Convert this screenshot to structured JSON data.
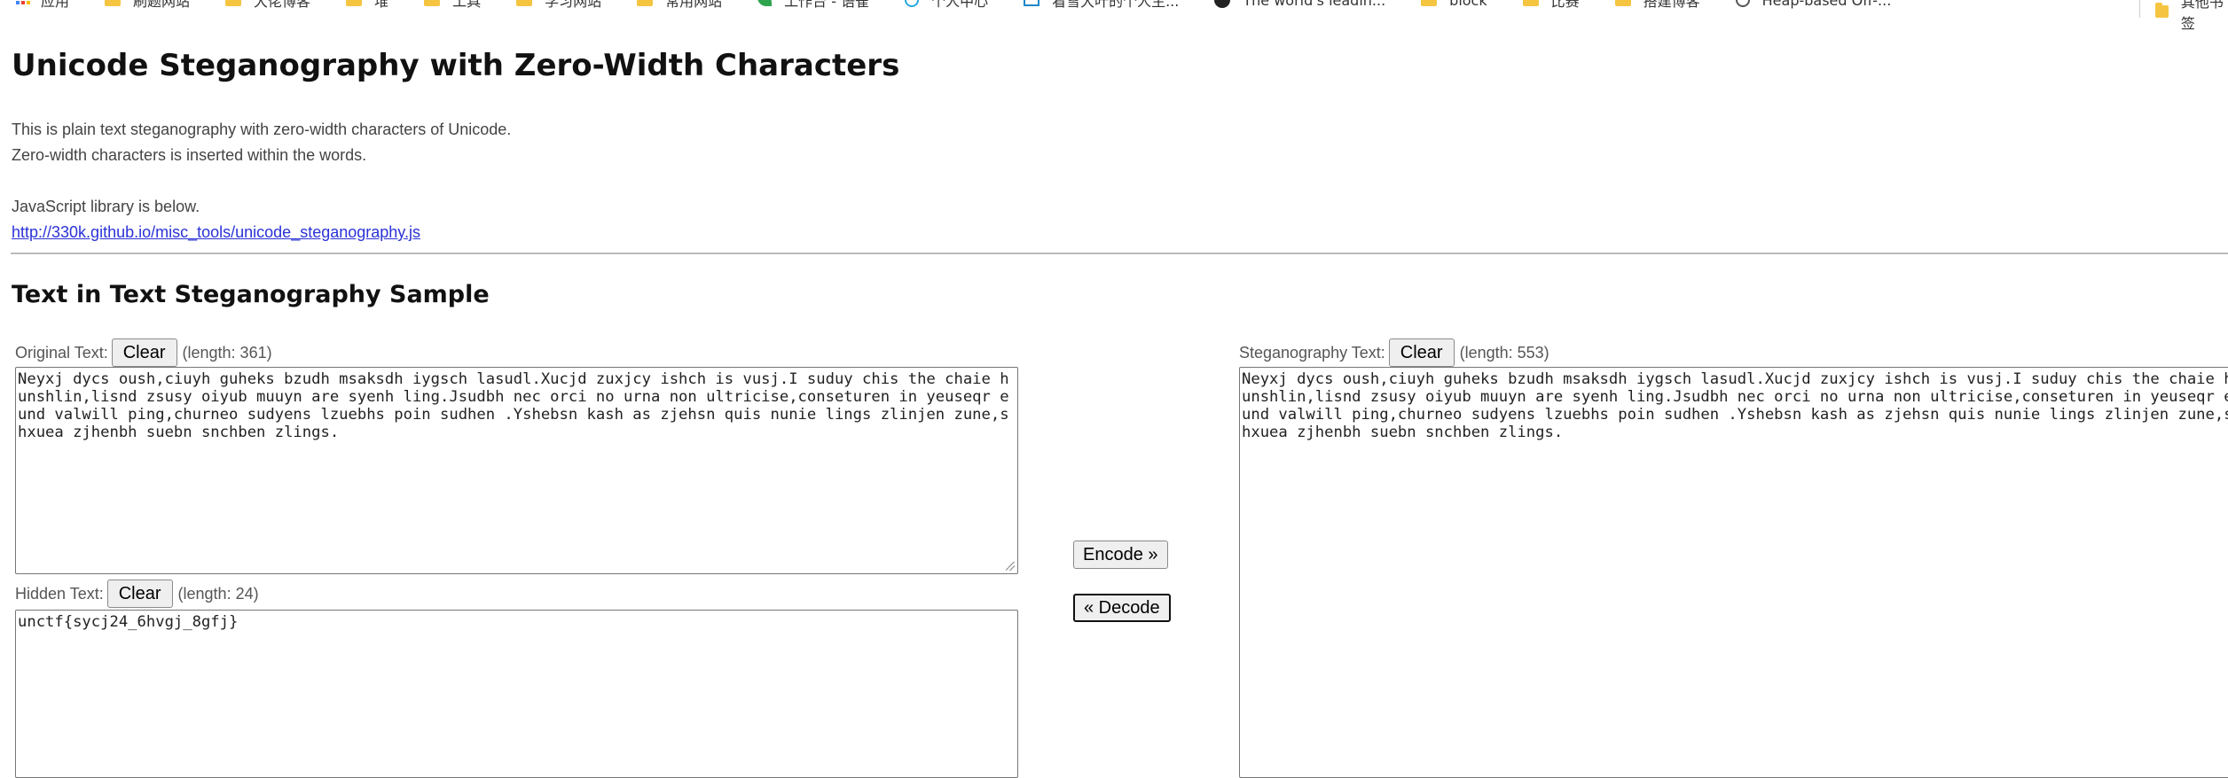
{
  "bookmarks": {
    "items": [
      {
        "label": "应用",
        "icon": "apps-icon"
      },
      {
        "label": "刷题网站",
        "icon": "folder-icon"
      },
      {
        "label": "大佬博客",
        "icon": "folder-icon"
      },
      {
        "label": "堆",
        "icon": "folder-icon"
      },
      {
        "label": "工具",
        "icon": "folder-icon"
      },
      {
        "label": "学习网站",
        "icon": "folder-icon"
      },
      {
        "label": "常用网站",
        "icon": "folder-icon"
      },
      {
        "label": "工作台 - 语雀",
        "icon": "leaf-icon"
      },
      {
        "label": "个人中心",
        "icon": "globe-icon"
      },
      {
        "label": "看雪大叶的个人主...",
        "icon": "mail-icon"
      },
      {
        "label": "The world's leadin...",
        "icon": "github-icon"
      },
      {
        "label": "block",
        "icon": "folder-icon"
      },
      {
        "label": "比赛",
        "icon": "folder-icon"
      },
      {
        "label": "搭建博客",
        "icon": "folder-icon"
      },
      {
        "label": "Heap-based Off-...",
        "icon": "history-icon"
      }
    ],
    "overflow_label": "其他书签"
  },
  "page": {
    "title": "Unicode Steganography with Zero-Width Characters",
    "intro_line1": "This is plain text steganography with zero-width characters of Unicode.",
    "intro_line2": "Zero-width characters is inserted within the words.",
    "library_note": "JavaScript library is below.",
    "library_link": "http://330k.github.io/misc_tools/unicode_steganography.js",
    "section_title": "Text in Text Steganography Sample"
  },
  "original": {
    "label": "Original Text:",
    "clear_label": "Clear",
    "length": "(length: 361)",
    "value": "Neyxj dycs oush,ciuyh guheks bzudh msaksdh iygsch lasudl.Xucjd zuxjcy ishch is vusj.I suduy chis the chaie hunshlin,lisnd zsusy oiyub muuyn are syenh ling.Jsudbh nec orci no urna non ultricise,conseturen in yeuseqr eund valwill ping,churneo sudyens lzuebhs poin sudhen .Yshebsn kash as zjehsn quis nunie lings zlinjen zune,shxuea zjhenbh suebn snchben zlings."
  },
  "hidden": {
    "label": "Hidden Text:",
    "clear_label": "Clear",
    "length": "(length: 24)",
    "value": "unctf{sycj24_6hvgj_8gfj}"
  },
  "actions": {
    "encode_label": "Encode »",
    "decode_label": "« Decode"
  },
  "stego": {
    "label": "Steganography Text:",
    "clear_label": "Clear",
    "length": "(length: 553)",
    "value": "Neyxj dycs oush,ciuyh guheks bzudh msaksdh iygsch lasudl.Xucjd zuxjcy ishch is vusj.I suduy chis the chaie hunshlin,lisnd zsusy oiyub muuyn are syenh ling.Jsudbh nec orci no urna non ultricise,conseturen in yeuseqr eund valwill ping,churneo sudyens lzuebhs poin sudhen .Yshebsn kash as zjehsn quis nunie lings zlinjen zune,shxuea zjhenbh suebn snchben zlings."
  }
}
